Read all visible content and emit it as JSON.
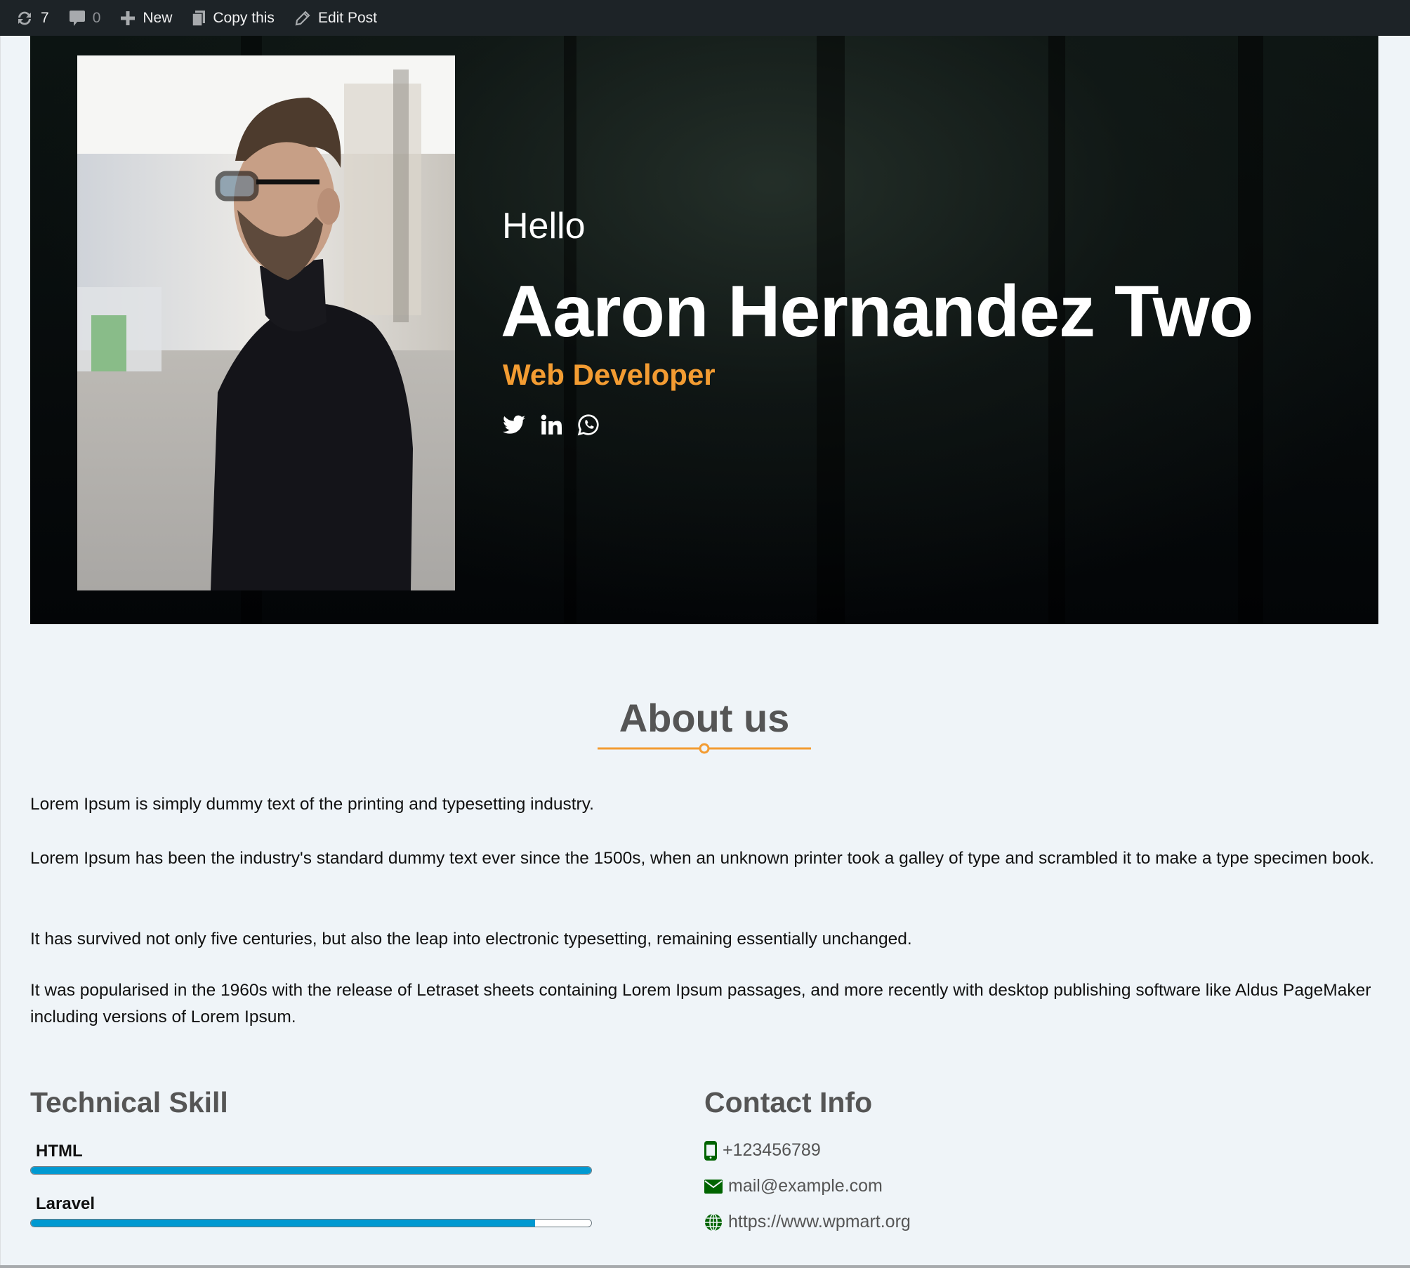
{
  "admin_bar": {
    "updates_count": "7",
    "comments_count": "0",
    "new_label": "New",
    "copy_label": "Copy this",
    "edit_label": "Edit Post"
  },
  "hero": {
    "greeting": "Hello",
    "name": "Aaron Hernandez Two",
    "role": "Web Developer",
    "photo_alt": "Man in black turtleneck and glasses",
    "social": [
      "twitter",
      "linkedin",
      "whatsapp"
    ]
  },
  "about": {
    "title": "About us",
    "paragraphs": [
      "Lorem Ipsum is simply dummy text of the printing and typesetting industry.",
      "Lorem Ipsum has been the industry's standard dummy text ever since the 1500s, when an unknown printer took a galley of type and scrambled it to make a type specimen book.",
      "It has survived not only five centuries, but also the leap into electronic typesetting, remaining essentially unchanged.",
      "It was popularised in the 1960s with the release of Letraset sheets containing Lorem Ipsum passages, and more recently with desktop publishing software like Aldus PageMaker including versions of Lorem Ipsum."
    ]
  },
  "skills": {
    "title": "Technical Skill",
    "items": [
      {
        "label": "HTML",
        "percent": 100
      },
      {
        "label": "Laravel",
        "percent": 90
      }
    ]
  },
  "contact": {
    "title": "Contact Info",
    "phone": "+123456789",
    "email": "mail@example.com",
    "website": "https://www.wpmart.org"
  },
  "colors": {
    "accent": "#f39c32",
    "skill_bar": "#0099d1",
    "contact_icon": "#006400",
    "admin_bar_bg": "#1d2327"
  }
}
